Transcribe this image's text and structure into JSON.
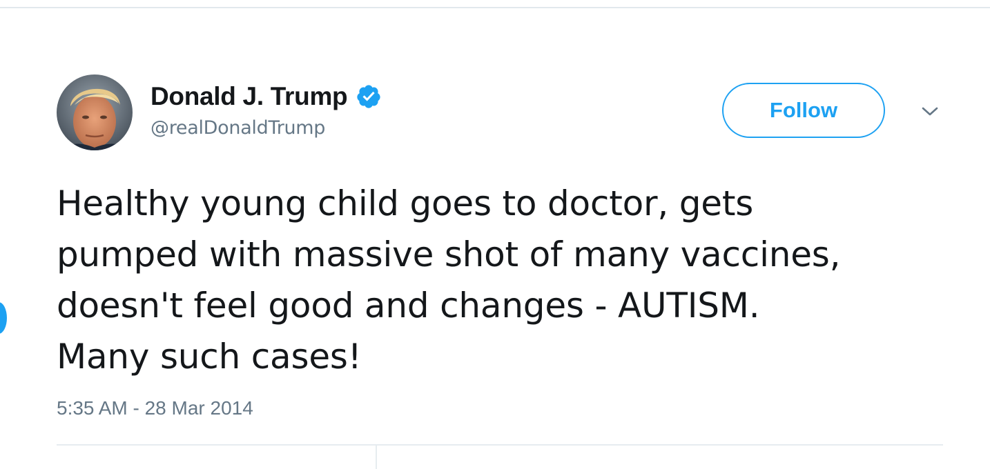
{
  "tweet": {
    "author": {
      "display_name": "Donald J. Trump",
      "handle": "@realDonaldTrump",
      "verified": true,
      "avatar": "avatar-photo"
    },
    "follow_label": "Follow",
    "text_lines": [
      "Healthy young child goes to doctor, gets",
      "pumped with massive shot of many vaccines,",
      "doesn't feel good and changes - AUTISM.",
      "Many such cases!"
    ],
    "timestamp": "5:35 AM - 28 Mar 2014"
  },
  "icons": {
    "verified": "verified-badge-icon",
    "menu": "chevron-down-icon"
  },
  "colors": {
    "accent": "#1da1f2",
    "text": "#14171a",
    "secondary_text": "#657786",
    "divider": "#e6ecf0"
  }
}
